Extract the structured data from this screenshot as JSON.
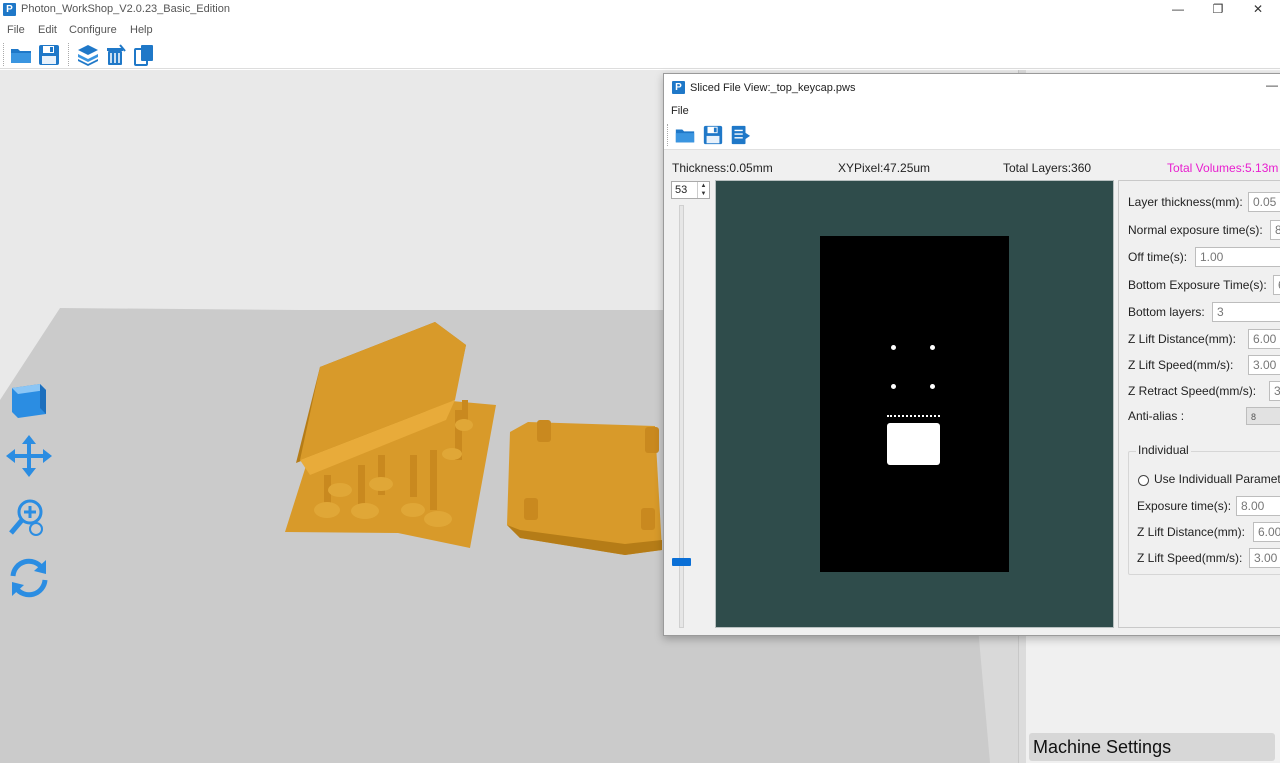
{
  "window": {
    "title": "Photon_WorkShop_V2.0.23_Basic_Edition",
    "icon": "P",
    "minimize": "—",
    "restore": "❐",
    "close": "✕"
  },
  "menu": [
    "File",
    "Edit",
    "Configure",
    "Help"
  ],
  "toolbar": {
    "icons": [
      "open-folder-icon",
      "save-icon",
      "slice-layers-icon",
      "clear-trash-icon",
      "copy-icon"
    ]
  },
  "viewport": {
    "tools": [
      "cube-view-icon",
      "move-icon",
      "zoom-icon",
      "rotate-icon"
    ],
    "model_color": "#d89a2a",
    "plate_color": "#cbcbcb"
  },
  "right_panel": {
    "machine_settings_label": "Machine Settings"
  },
  "dialog": {
    "title": "Sliced File View:_top_keycap.pws",
    "icon": "P",
    "minimize": "—",
    "menu_file": "File",
    "toolbar_icons": [
      "open-folder-icon",
      "save-icon",
      "export-icon"
    ],
    "info": {
      "thickness": "Thickness:0.05mm",
      "xypixel": "XYPixel:47.25um",
      "total_layers": "Total Layers:360",
      "total_volumes": "Total Volumes:5.13m"
    },
    "layer_spin_value": "53",
    "layer_position_fraction": 0.147,
    "params": {
      "layer_thickness_label": "Layer thickness(mm):",
      "layer_thickness_value": "0.05",
      "normal_exposure_label": "Normal exposure time(s):",
      "normal_exposure_value": "8",
      "off_time_label": "Off time(s):",
      "off_time_value": "1.00",
      "bottom_exposure_label": "Bottom Exposure Time(s):",
      "bottom_exposure_value": "6",
      "bottom_layers_label": "Bottom layers:",
      "bottom_layers_value": "3",
      "z_lift_distance_label": "Z Lift Distance(mm):",
      "z_lift_distance_value": "6.00",
      "z_lift_speed_label": "Z Lift Speed(mm/s):",
      "z_lift_speed_value": "3.00",
      "z_retract_speed_label": "Z Retract Speed(mm/s):",
      "z_retract_speed_value": "3.0",
      "anti_alias_label": "Anti-alias :",
      "anti_alias_value": "8"
    },
    "individual": {
      "group_title": "Individual",
      "use_individual_label": "Use Individuall Paramet",
      "exposure_label": "Exposure time(s):",
      "exposure_value": "8.00",
      "z_lift_distance_label": "Z Lift Distance(mm):",
      "z_lift_distance_value": "6.00",
      "z_lift_speed_label": "Z Lift Speed(mm/s):",
      "z_lift_speed_value": "3.00"
    }
  }
}
